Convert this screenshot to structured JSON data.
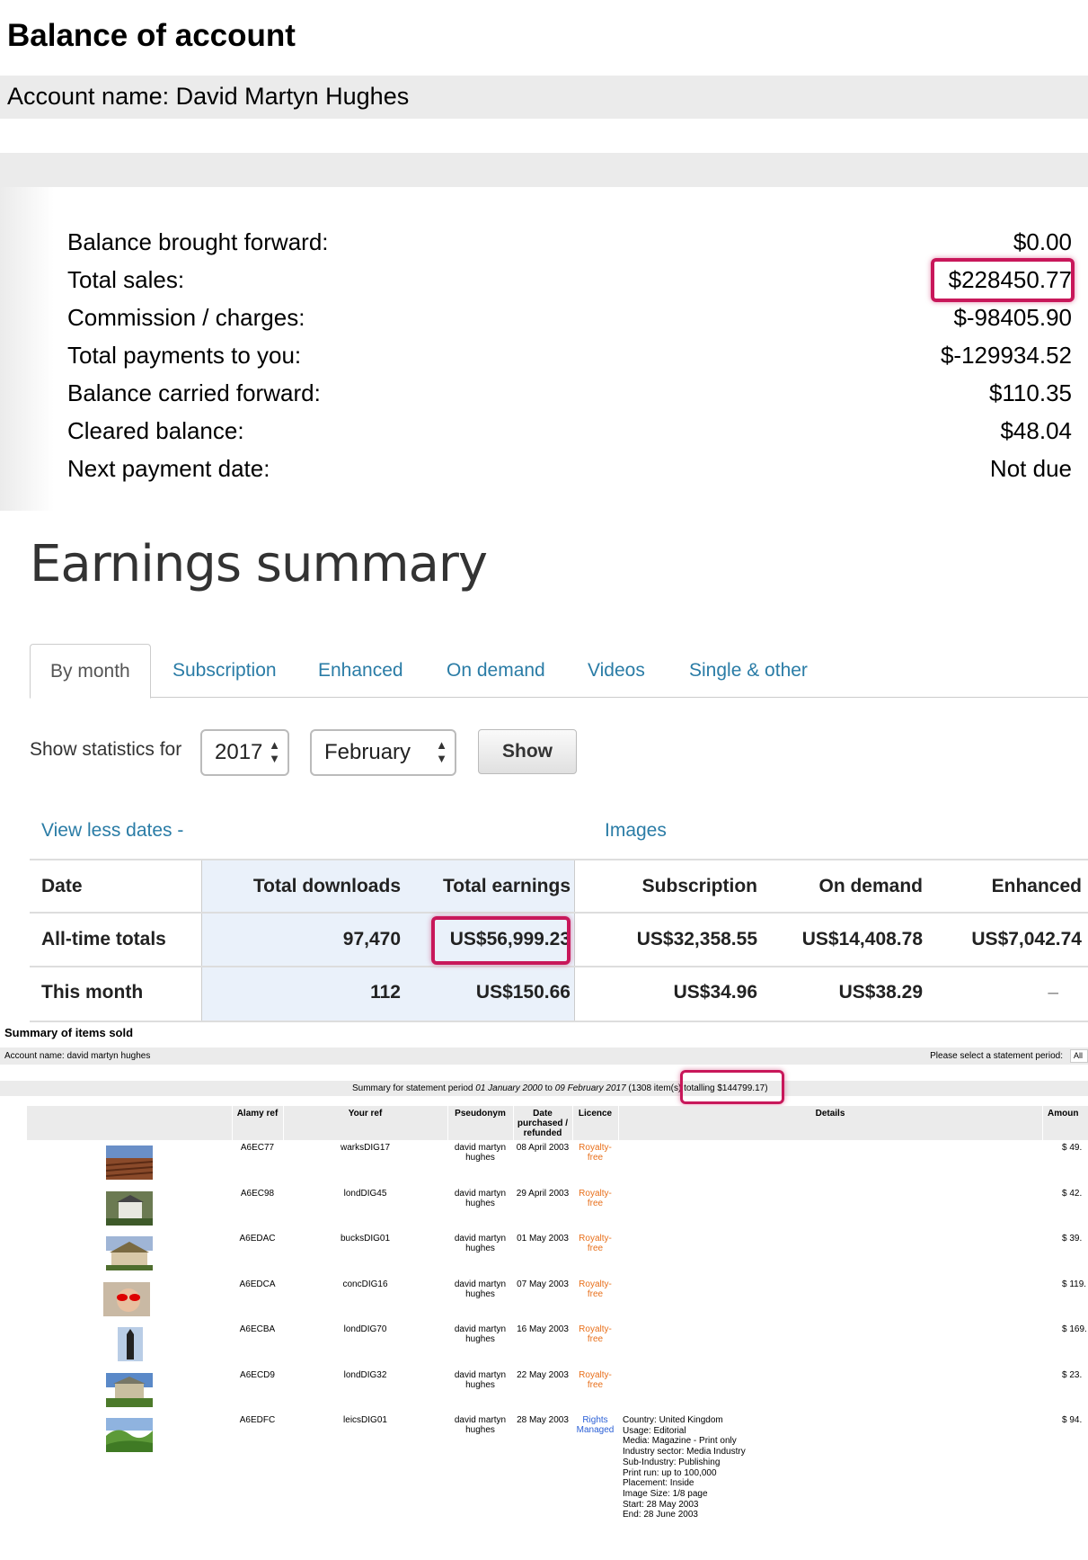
{
  "balance": {
    "title": "Balance of account",
    "account_name": "Account name: David Martyn Hughes",
    "rows": [
      {
        "label": "Balance brought forward:",
        "value": "$0.00"
      },
      {
        "label": "Total sales:",
        "value": "$228450.77"
      },
      {
        "label": "Commission / charges:",
        "value": "$-98405.90"
      },
      {
        "label": "Total payments to you:",
        "value": "$-129934.52"
      },
      {
        "label": "Balance carried forward:",
        "value": "$110.35"
      },
      {
        "label": "Cleared balance:",
        "value": "$48.04"
      },
      {
        "label": "Next payment date:",
        "value": "Not due"
      }
    ]
  },
  "earnings": {
    "title": "Earnings summary",
    "tabs": [
      "By month",
      "Subscription",
      "Enhanced",
      "On demand",
      "Videos",
      "Single & other"
    ],
    "show_stats_label": "Show statistics for",
    "year": "2017",
    "month": "February",
    "show_button": "Show",
    "view_less": "View less dates -",
    "images_label": "Images",
    "headers": [
      "Date",
      "Total downloads",
      "Total earnings",
      "Subscription",
      "On demand",
      "Enhanced"
    ],
    "rows": [
      {
        "date": "All-time totals",
        "downloads": "97,470",
        "earnings": "US$56,999.23",
        "subscription": "US$32,358.55",
        "on_demand": "US$14,408.78",
        "enhanced": "US$7,042.74"
      },
      {
        "date": "This month",
        "downloads": "112",
        "earnings": "US$150.66",
        "subscription": "US$34.96",
        "on_demand": "US$38.29",
        "enhanced": "–"
      }
    ]
  },
  "summary": {
    "title": "Summary of items sold",
    "account_name": "Account name: david martyn hughes",
    "period_prompt": "Please select a statement period:",
    "period_select": "All",
    "period_text_a": "Summary for statement period ",
    "period_from": "01 January 2000",
    "period_text_b": " to ",
    "period_to": "09 February 2017",
    "period_text_c": " (1308 item(s) totalling $144799.17)",
    "headers": {
      "alamy_ref": "Alamy ref",
      "your_ref": "Your ref",
      "pseudonym": "Pseudonym",
      "date": "Date purchased / refunded",
      "licence": "Licence",
      "details": "Details",
      "amount": "Amoun"
    },
    "items": [
      {
        "alamy_ref": "A6EC77",
        "your_ref": "warksDIG17",
        "pseudonym": "david martyn hughes",
        "date": "08 April 2003",
        "licence": "Royalty-free",
        "details": "",
        "amount": "$ 49.",
        "thumb": "field"
      },
      {
        "alamy_ref": "A6EC98",
        "your_ref": "londDIG45",
        "pseudonym": "david martyn hughes",
        "date": "29 April 2003",
        "licence": "Royalty-free",
        "details": "",
        "amount": "$ 42.",
        "thumb": "house"
      },
      {
        "alamy_ref": "A6EDAC",
        "your_ref": "bucksDIG01",
        "pseudonym": "david martyn hughes",
        "date": "01 May 2003",
        "licence": "Royalty-free",
        "details": "",
        "amount": "$ 39.",
        "thumb": "cottage"
      },
      {
        "alamy_ref": "A6EDCA",
        "your_ref": "concDIG16",
        "pseudonym": "david martyn hughes",
        "date": "07 May 2003",
        "licence": "Royalty-free",
        "details": "",
        "amount": "$ 119.",
        "thumb": "child"
      },
      {
        "alamy_ref": "A6ECBA",
        "your_ref": "londDIG70",
        "pseudonym": "david martyn hughes",
        "date": "16 May 2003",
        "licence": "Royalty-free",
        "details": "",
        "amount": "$ 169.",
        "thumb": "tower"
      },
      {
        "alamy_ref": "A6ECD9",
        "your_ref": "londDIG32",
        "pseudonym": "david martyn hughes",
        "date": "22 May 2003",
        "licence": "Royalty-free",
        "details": "",
        "amount": "$ 23.",
        "thumb": "manor"
      },
      {
        "alamy_ref": "A6EDFC",
        "your_ref": "leicsDIG01",
        "pseudonym": "david martyn hughes",
        "date": "28 May 2003",
        "licence": "Rights Managed",
        "details": "Country: United Kingdom\nUsage: Editorial\nMedia: Magazine - Print only\nIndustry sector: Media Industry\nSub-Industry: Publishing\nPrint run: up to 100,000\nPlacement: Inside\nImage Size: 1/8 page\nStart: 28 May 2003\nEnd: 28 June 2003",
        "amount": "$ 94.",
        "thumb": "hills"
      }
    ]
  },
  "colors": {
    "highlight": "#c8175a",
    "link": "#2a7ca6",
    "royalty_free": "#e86f1a",
    "rights_managed": "#2a5fd6"
  }
}
